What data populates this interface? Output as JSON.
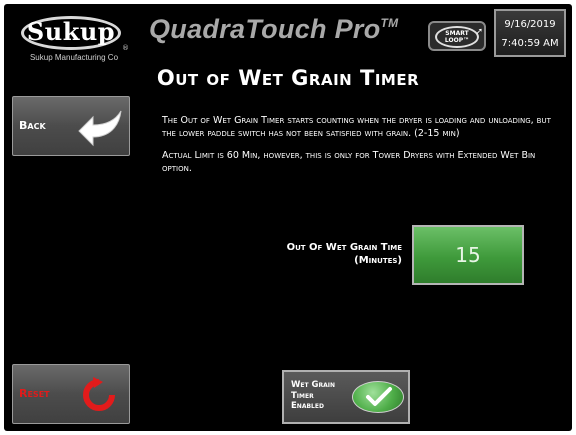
{
  "header": {
    "logo_text": "Sukup",
    "logo_registered": "®",
    "company": "Sukup Manufacturing Co",
    "product_name": "QuadraTouch Pro",
    "product_tm": "TM",
    "smartloop_line1": "SMART",
    "smartloop_line2": "LOOP™",
    "date": "9/16/2019",
    "time": "7:40:59 AM"
  },
  "page": {
    "title": "Out of Wet Grain Timer",
    "description_1": "The Out of Wet Grain Timer starts counting when the dryer is loading and unloading, but the lower paddle switch has not been satisfied with grain. (2-15 min)",
    "description_2": "Actual Limit is 60 Min, however, this is only for Tower Dryers with Extended Wet Bin option."
  },
  "buttons": {
    "back_label": "Back",
    "reset_label": "Reset"
  },
  "setting": {
    "label_line1": "Out Of Wet Grain Time",
    "label_line2": "(Minutes)",
    "value": "15"
  },
  "toggle": {
    "line1": "Wet Grain",
    "line2": "Timer",
    "line3": "Enabled",
    "enabled": true
  },
  "colors": {
    "background": "#000000",
    "value_green": "#3f9a3b",
    "reset_red": "#e21b1b",
    "button_gray": "#4c4c4c"
  },
  "icons": {
    "back": "back-arrow-icon",
    "reset": "reset-circular-arrow-icon",
    "enabled": "checkmark-icon"
  }
}
